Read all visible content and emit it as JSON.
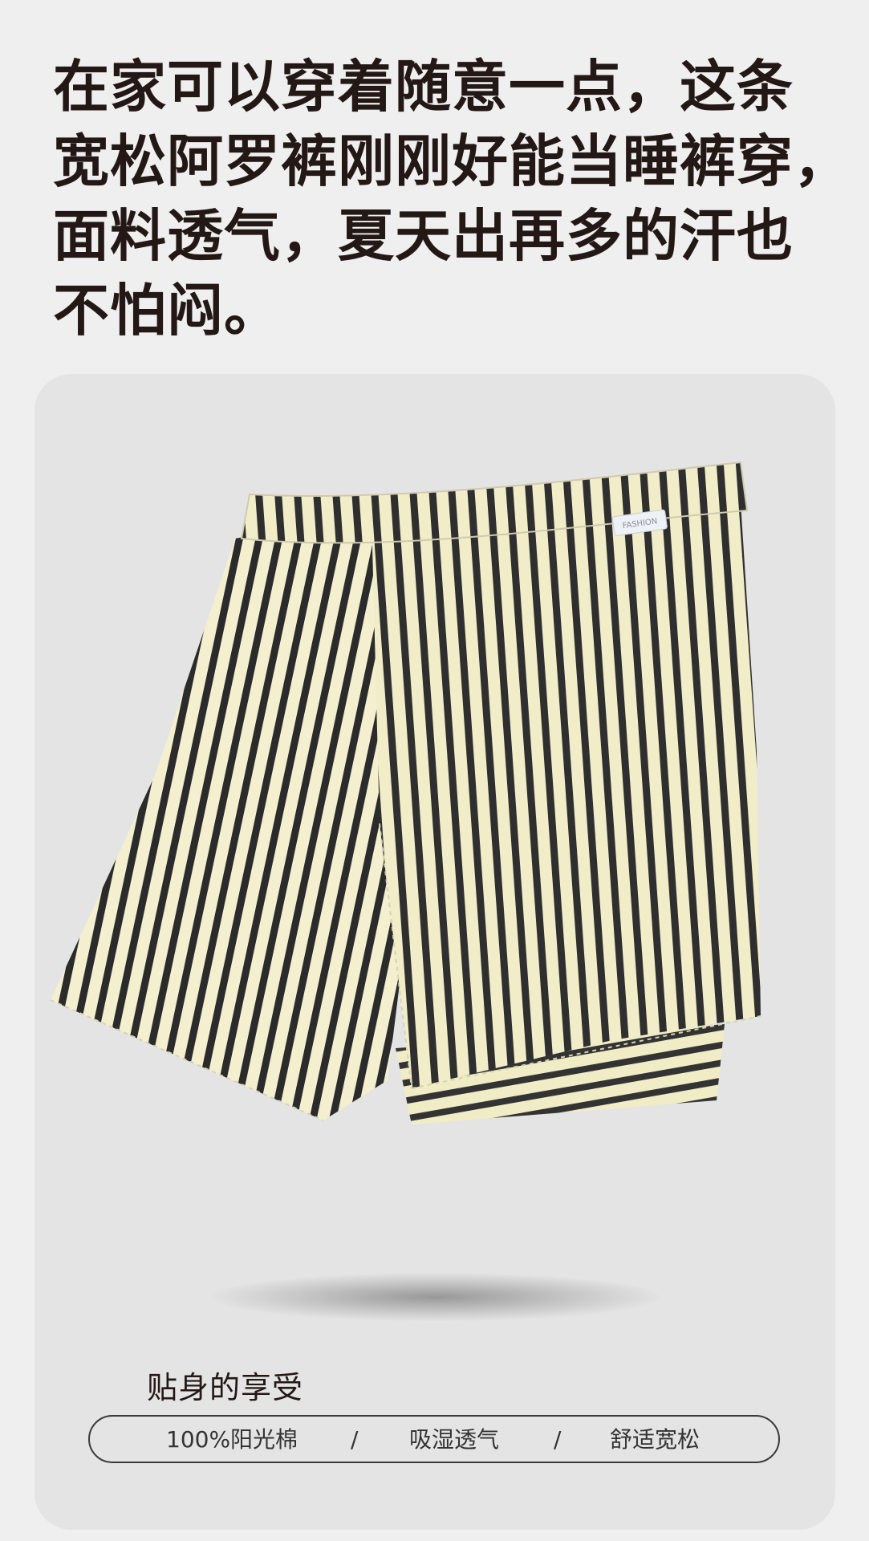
{
  "headline": {
    "lines": [
      "在家可以穿着随意一点，这条",
      "宽松阿罗裤刚刚好能当睡裤穿，",
      "面料透气，夏天出再多的汗也",
      "不怕闷。"
    ]
  },
  "product": {
    "label_text": "FASHION",
    "stripe_colors": [
      "#2b2b2b",
      "#f3efcf"
    ]
  },
  "card": {
    "subtitle": "贴身的享受",
    "features": [
      "100%阳光棉",
      "吸湿透气",
      "舒适宽松"
    ],
    "separator": "/"
  }
}
